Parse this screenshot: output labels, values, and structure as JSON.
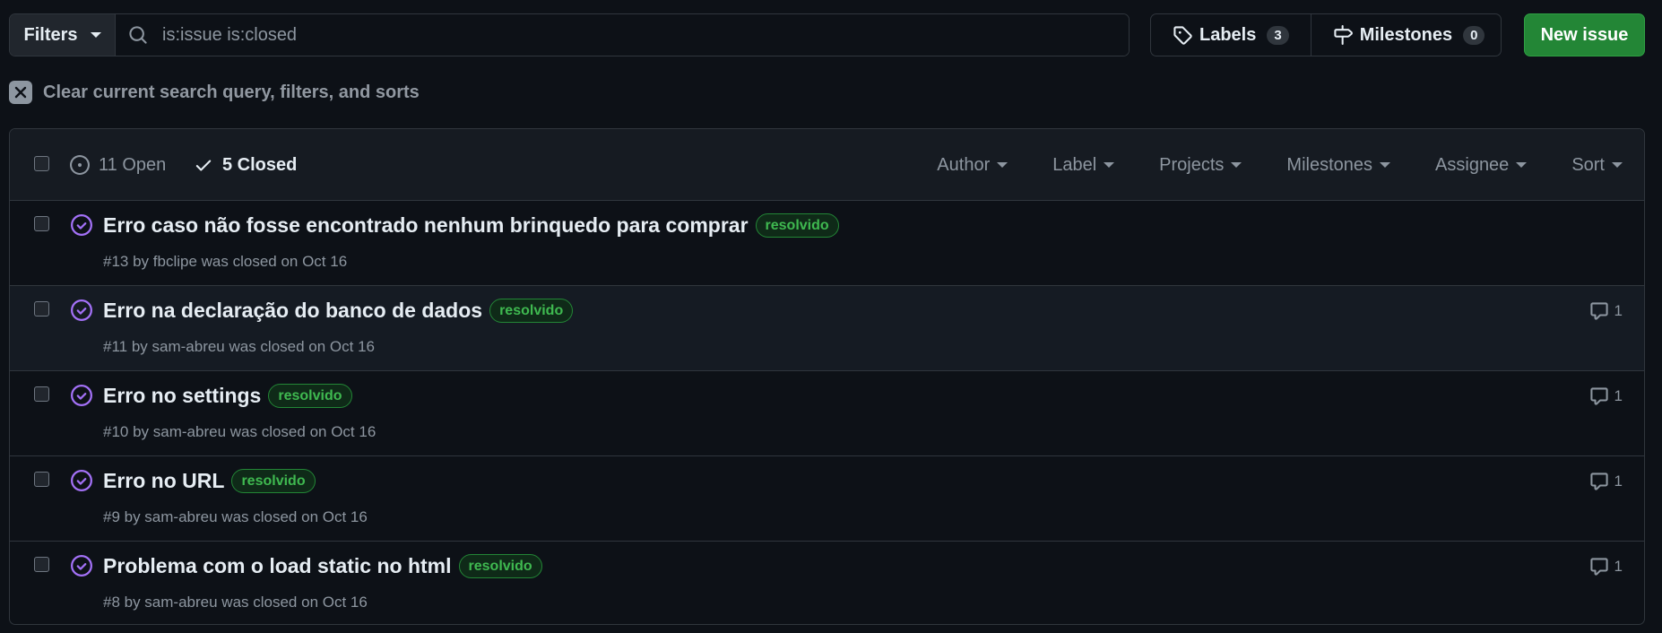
{
  "search": {
    "filters_label": "Filters",
    "query": "is:issue is:closed"
  },
  "labels_btn": {
    "label": "Labels",
    "count": "3"
  },
  "milestones_btn": {
    "label": "Milestones",
    "count": "0"
  },
  "new_issue_label": "New issue",
  "clear_text": "Clear current search query, filters, and sorts",
  "header": {
    "open_label": "11 Open",
    "closed_label": "5 Closed",
    "menus": {
      "author": "Author",
      "label": "Label",
      "projects": "Projects",
      "milestones": "Milestones",
      "assignee": "Assignee",
      "sort": "Sort"
    }
  },
  "issues": [
    {
      "title": "Erro caso não fosse encontrado nenhum brinquedo para comprar",
      "label": "resolvido",
      "meta": "#13 by fbclipe was closed on Oct 16",
      "comments": ""
    },
    {
      "title": "Erro na declaração do banco de dados",
      "label": "resolvido",
      "meta": "#11 by sam-abreu was closed on Oct 16",
      "comments": "1"
    },
    {
      "title": "Erro no settings",
      "label": "resolvido",
      "meta": "#10 by sam-abreu was closed on Oct 16",
      "comments": "1"
    },
    {
      "title": "Erro no URL",
      "label": "resolvido",
      "meta": "#9 by sam-abreu was closed on Oct 16",
      "comments": "1"
    },
    {
      "title": "Problema com o load static no html",
      "label": "resolvido",
      "meta": "#8 by sam-abreu was closed on Oct 16",
      "comments": "1"
    }
  ],
  "colors": {
    "background": "#0d1117",
    "closed_icon": "#a371f7",
    "label_text": "#3fb950",
    "new_issue_bg": "#238636"
  },
  "icons": {
    "search": "search-icon",
    "tag": "tag-icon",
    "milestone": "milestone-icon",
    "clear": "close-icon",
    "open": "issue-opened-icon",
    "check": "check-icon",
    "closed": "issue-closed-icon",
    "comment": "comment-icon"
  }
}
